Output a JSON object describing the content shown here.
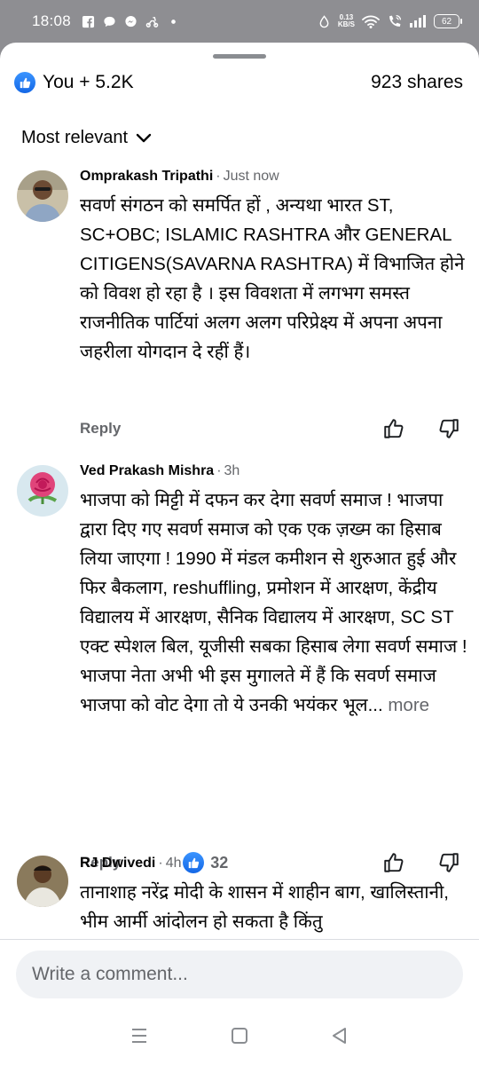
{
  "status_bar": {
    "time": "18:08",
    "net_speed_value": "0.13",
    "net_speed_unit": "KB/S",
    "battery": "62",
    "icons": [
      "facebook-icon",
      "chat-bubble-icon",
      "messenger-icon",
      "scooter-icon",
      "dot-icon",
      "data-drop-icon",
      "wifi-icon",
      "wifi-call-icon",
      "signal-icon",
      "battery-icon"
    ]
  },
  "reactions": {
    "label": "You + 5.2K",
    "shares": "923 shares",
    "accent": "#1877f2"
  },
  "sort": {
    "label": "Most relevant"
  },
  "comments": [
    {
      "author": "Omprakash Tripathi",
      "time": "Just now",
      "text": "सवर्ण संगठन को समर्पित हों , अन्यथा भारत ST, SC+OBC; ISLAMIC RASHTRA और GENERAL CITIGENS(SAVARNA RASHTRA) में विभाजित होने को विवश हो रहा है । इस विवशता में लगभग समस्त राजनीतिक पार्टियां अलग अलग परिप्रेक्ष्य में अपना अपना जहरीला योगदान दे रहीं हैं।",
      "reply_label": "Reply"
    },
    {
      "author": "Ved Prakash Mishra",
      "time": "3h",
      "text": "भाजपा को मिट्टी में दफन कर देगा सवर्ण समाज ! भाजपा द्वारा दिए गए सवर्ण समाज को एक एक ज़ख्म का हिसाब लिया जाएगा ! 1990 में मंडल कमीशन से शुरुआत हुई और फिर बैकलाग, reshuffling, प्रमोशन में आरक्षण, केंद्रीय विद्यालय में आरक्षण, सैनिक विद्यालय में आरक्षण, SC ST एक्ट स्पेशल बिल, यूजीसी सबका हिसाब लेगा सवर्ण समाज ! भाजपा नेता अभी भी इस मुगालते में हैं कि सवर्ण समाज भाजपा को वोट देगा तो ये उनकी भयंकर भूल...",
      "more_label": "more",
      "reply_label": "Reply",
      "like_count": "32"
    },
    {
      "author": "RJ Dwivedi",
      "time": "4h",
      "text": "तानाशाह नरेंद्र मोदी के शासन में शाहीन बाग, खालिस्तानी, भीम आर्मी आंदोलन हो सकता है किंतु"
    }
  ],
  "composer": {
    "placeholder": "Write a comment..."
  },
  "nav": {
    "icons": [
      "menu-icon",
      "home-square-icon",
      "back-triangle-icon"
    ]
  }
}
